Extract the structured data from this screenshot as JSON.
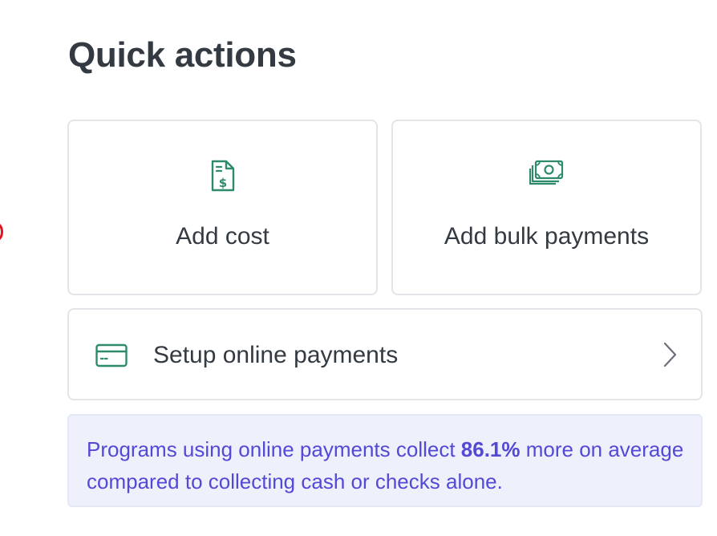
{
  "title": "Quick actions",
  "actions": {
    "add_cost": {
      "label": "Add cost",
      "icon": "receipt-dollar-icon"
    },
    "add_bulk_payments": {
      "label": "Add bulk payments",
      "icon": "money-stack-icon"
    },
    "setup_online_payments": {
      "label": "Setup online payments",
      "icon": "credit-card-icon",
      "trailing_icon": "chevron-right-icon"
    }
  },
  "info": {
    "text_before": "Programs using online payments collect ",
    "highlight": "86.1%",
    "text_after": " more on average compared to collecting cash or checks alone."
  },
  "colors": {
    "icon_accent": "#2e8b6a",
    "info_text": "#5448d6",
    "info_background": "#eef1fc",
    "title_text": "#343a42"
  }
}
